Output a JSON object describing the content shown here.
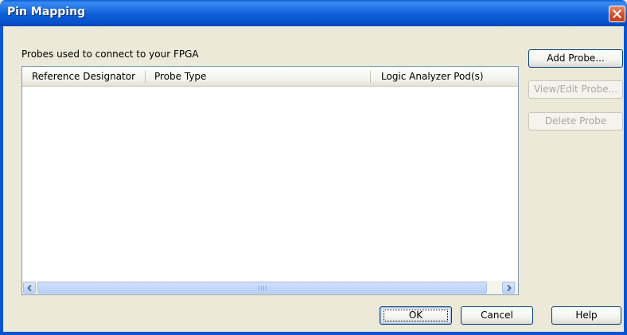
{
  "window": {
    "title": "Pin Mapping",
    "close_icon": "close-icon"
  },
  "probes": {
    "label": "Probes used to connect to your FPGA",
    "columns": [
      "Reference Designator",
      "Probe Type",
      "Logic Analyzer Pod(s)"
    ],
    "rows": []
  },
  "side_buttons": {
    "add": "Add Probe...",
    "view_edit": "View/Edit Probe...",
    "delete": "Delete Probe"
  },
  "footer_buttons": {
    "ok": "OK",
    "cancel": "Cancel",
    "help": "Help"
  },
  "colors": {
    "titlebar": "#0a5fd6",
    "dialog_bg": "#ece9d8",
    "list_border": "#7f9db9"
  }
}
